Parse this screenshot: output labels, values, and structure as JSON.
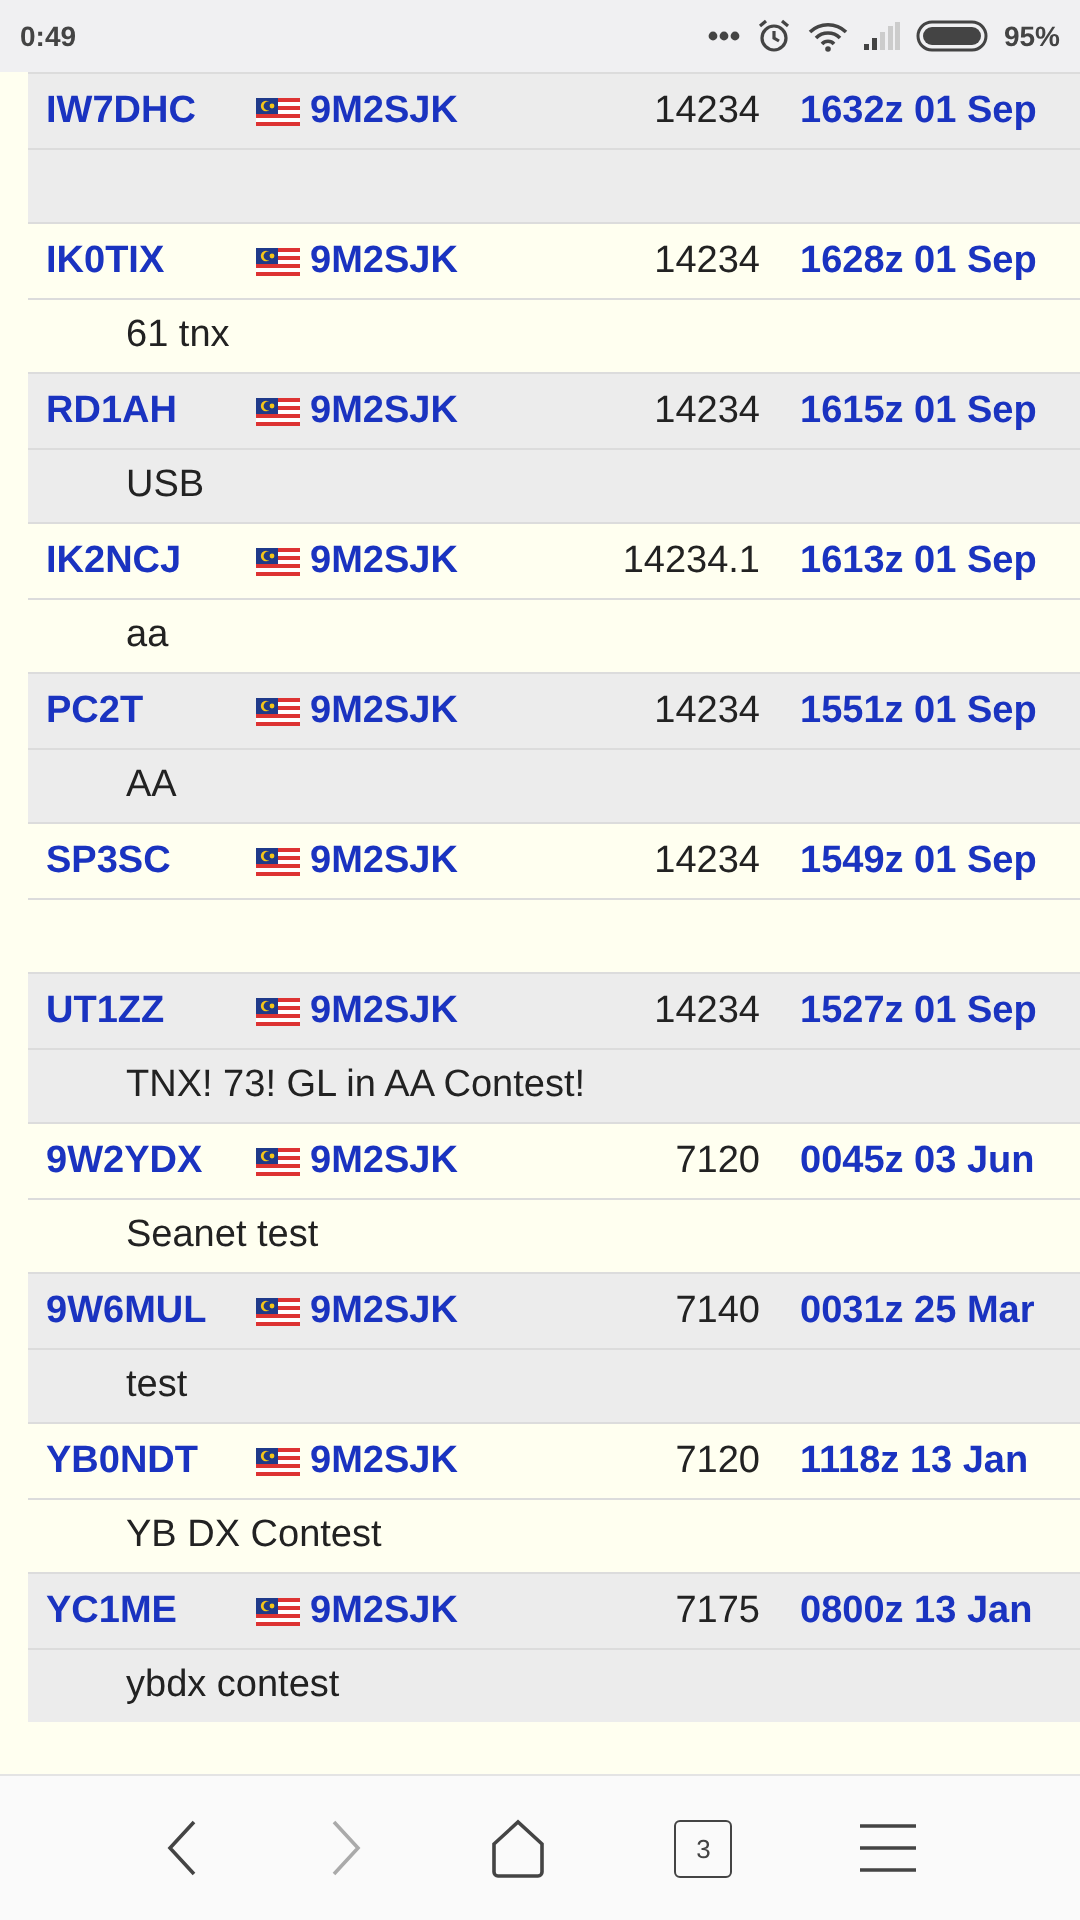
{
  "status_bar": {
    "time": "0:49",
    "battery": "95%"
  },
  "spots": [
    {
      "spotter": "IW7DHC",
      "dx": "9M2SJK",
      "freq": "14234",
      "time": "1632z 01 Sep"
    },
    {
      "spotter": "IK0TIX",
      "dx": "9M2SJK",
      "freq": "14234",
      "time": "1628z 01 Sep",
      "comment": "61 tnx"
    },
    {
      "spotter": "RD1AH",
      "dx": "9M2SJK",
      "freq": "14234",
      "time": "1615z 01 Sep",
      "comment": "USB"
    },
    {
      "spotter": "IK2NCJ",
      "dx": "9M2SJK",
      "freq": "14234.1",
      "time": "1613z 01 Sep",
      "comment": "aa"
    },
    {
      "spotter": "PC2T",
      "dx": "9M2SJK",
      "freq": "14234",
      "time": "1551z 01 Sep",
      "comment": "AA"
    },
    {
      "spotter": "SP3SC",
      "dx": "9M2SJK",
      "freq": "14234",
      "time": "1549z 01 Sep"
    },
    {
      "spotter": "UT1ZZ",
      "dx": "9M2SJK",
      "freq": "14234",
      "time": "1527z 01 Sep",
      "comment": "TNX! 73! GL in AA Contest!"
    },
    {
      "spotter": "9W2YDX",
      "dx": "9M2SJK",
      "freq": "7120",
      "time": "0045z 03 Jun",
      "comment": "Seanet test"
    },
    {
      "spotter": "9W6MUL",
      "dx": "9M2SJK",
      "freq": "7140",
      "time": "0031z 25 Mar",
      "comment": "test"
    },
    {
      "spotter": "YB0NDT",
      "dx": "9M2SJK",
      "freq": "7120",
      "time": "1118z 13 Jan",
      "comment": "YB DX Contest"
    },
    {
      "spotter": "YC1ME",
      "dx": "9M2SJK",
      "freq": "7175",
      "time": "0800z 13 Jan",
      "comment": "ybdx contest"
    }
  ],
  "nav_bar": {
    "back": {
      "disabled": false
    },
    "forward": {
      "disabled": true
    },
    "tab_count": "3"
  }
}
